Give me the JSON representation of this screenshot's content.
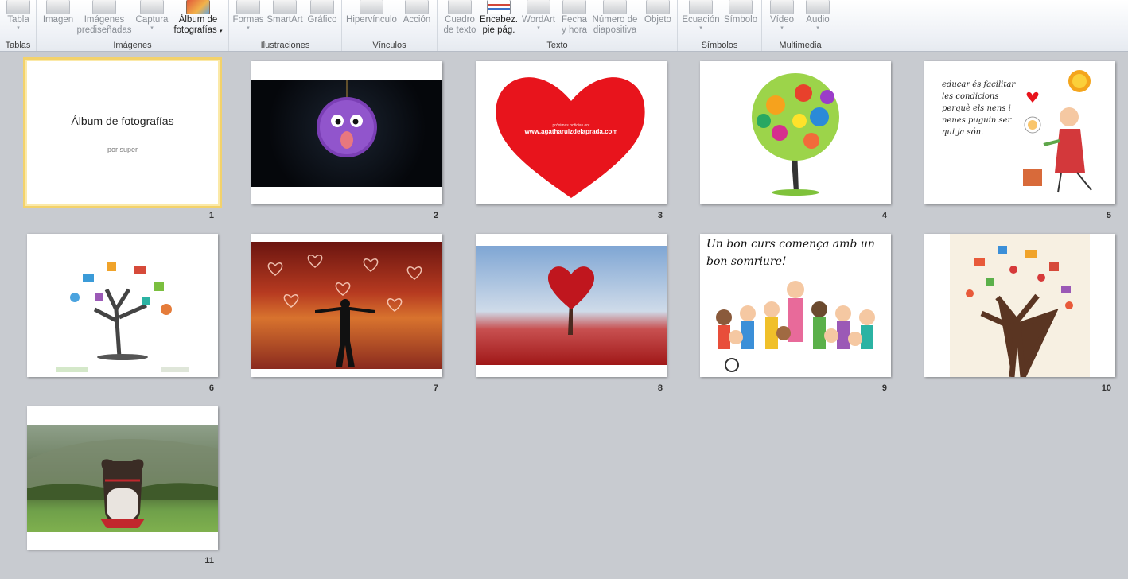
{
  "ribbon": {
    "groups": [
      {
        "label": "Tablas",
        "buttons": [
          {
            "label": "Tabla"
          }
        ]
      },
      {
        "label": "Imágenes",
        "buttons": [
          {
            "label": "Imagen"
          },
          {
            "label": "Imágenes prediseñadas",
            "line1": "Imágenes",
            "line2": "prediseñadas"
          },
          {
            "label": "Captura"
          },
          {
            "label": "Álbum de fotografías",
            "line1": "Álbum de",
            "line2": "fotografías"
          }
        ]
      },
      {
        "label": "Ilustraciones",
        "buttons": [
          {
            "label": "Formas"
          },
          {
            "label": "SmartArt"
          },
          {
            "label": "Gráfico"
          }
        ]
      },
      {
        "label": "Vínculos",
        "buttons": [
          {
            "label": "Hipervínculo"
          },
          {
            "label": "Acción"
          }
        ]
      },
      {
        "label": "Texto",
        "buttons": [
          {
            "label": "Cuadro de texto",
            "line1": "Cuadro",
            "line2": "de texto"
          },
          {
            "label": "Encabez. pie pág.",
            "line1": "Encabez.",
            "line2": "pie pág."
          },
          {
            "label": "WordArt"
          },
          {
            "label": "Fecha y hora",
            "line1": "Fecha",
            "line2": "y hora"
          },
          {
            "label": "Número de diapositiva",
            "line1": "Número de",
            "line2": "diapositiva"
          },
          {
            "label": "Objeto"
          }
        ]
      },
      {
        "label": "Símbolos",
        "buttons": [
          {
            "label": "Ecuación"
          },
          {
            "label": "Símbolo"
          }
        ]
      },
      {
        "label": "Multimedia",
        "buttons": [
          {
            "label": "Vídeo"
          },
          {
            "label": "Audio"
          }
        ]
      }
    ]
  },
  "slides": [
    {
      "number": "1",
      "title": "Álbum de fotografías",
      "subtitle": "por super"
    },
    {
      "number": "2"
    },
    {
      "number": "3",
      "caption_small": "próximas noticias en:",
      "caption": "www.agatharuizdelaprada.com"
    },
    {
      "number": "4"
    },
    {
      "number": "5",
      "handwriting": "educar és facilitar les condicions perquè els nens i nenes puguin ser qui ja són."
    },
    {
      "number": "6"
    },
    {
      "number": "7"
    },
    {
      "number": "8"
    },
    {
      "number": "9",
      "handwriting": "Un bon curs comença amb un bon somriure!"
    },
    {
      "number": "10"
    },
    {
      "number": "11"
    }
  ],
  "colors": {
    "selection": "#f3d26b",
    "background": "#c8cbd0",
    "heart_red": "#e8141c"
  }
}
